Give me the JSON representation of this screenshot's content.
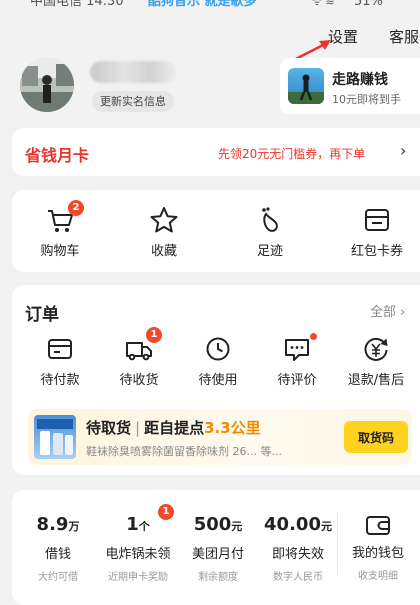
{
  "status_bar": {
    "carrier": "中国电信 14:30",
    "banner": "酷狗音乐  就是歌多",
    "icons": "ᯤ ≋",
    "battery": "51%"
  },
  "header": {
    "settings": "设置",
    "service": "客服"
  },
  "profile": {
    "realname_button": "更新实名信息"
  },
  "walk_promo": {
    "title": "走路赚钱",
    "subtitle": "10元即将到手"
  },
  "money_card": {
    "title": "省钱月卡",
    "promo": "先领20元无门槛券，再下单",
    "chevron": "›"
  },
  "quick_links": [
    {
      "label": "购物车",
      "icon": "cart-icon",
      "badge": "2"
    },
    {
      "label": "收藏",
      "icon": "star-icon"
    },
    {
      "label": "足迹",
      "icon": "footprint-icon"
    },
    {
      "label": "红包卡券",
      "icon": "coupon-icon"
    }
  ],
  "orders": {
    "title": "订单",
    "all": "全部 ›",
    "items": [
      {
        "label": "待付款",
        "icon": "payment-card-icon"
      },
      {
        "label": "待收货",
        "icon": "delivery-truck-icon",
        "badge": "1"
      },
      {
        "label": "待使用",
        "icon": "clock-icon"
      },
      {
        "label": "待评价",
        "icon": "comment-icon",
        "dot": true
      },
      {
        "label": "退款/售后",
        "icon": "refund-icon"
      }
    ],
    "pickup": {
      "title": "待取货",
      "separator": "|",
      "distance_prefix": "距自提点",
      "distance": "3.3公里",
      "description": "鞋袜除臭喷雾除菌留香除味剂 26... 等...",
      "button": "取货码"
    }
  },
  "wallet": {
    "items": [
      {
        "value": "8.9",
        "unit": "万",
        "label": "借钱",
        "sub": "大约可借"
      },
      {
        "value": "1",
        "unit": "个",
        "label": "电炸锅未领",
        "sub": "近期申卡奖励",
        "badge": "1"
      },
      {
        "value": "500",
        "unit": "元",
        "label": "美团月付",
        "sub": "剩余额度"
      },
      {
        "value": "40.00",
        "unit": "元",
        "label": "即将失效",
        "sub": "数字人民币"
      }
    ],
    "my_wallet": {
      "label": "我的钱包",
      "sub": "收支明细",
      "icon": "wallet-icon"
    }
  },
  "colors": {
    "accent_red": "#e8362c",
    "badge_red": "#f04a2a",
    "pickup_button": "#ffd21f",
    "distance_orange": "#f08c00"
  }
}
